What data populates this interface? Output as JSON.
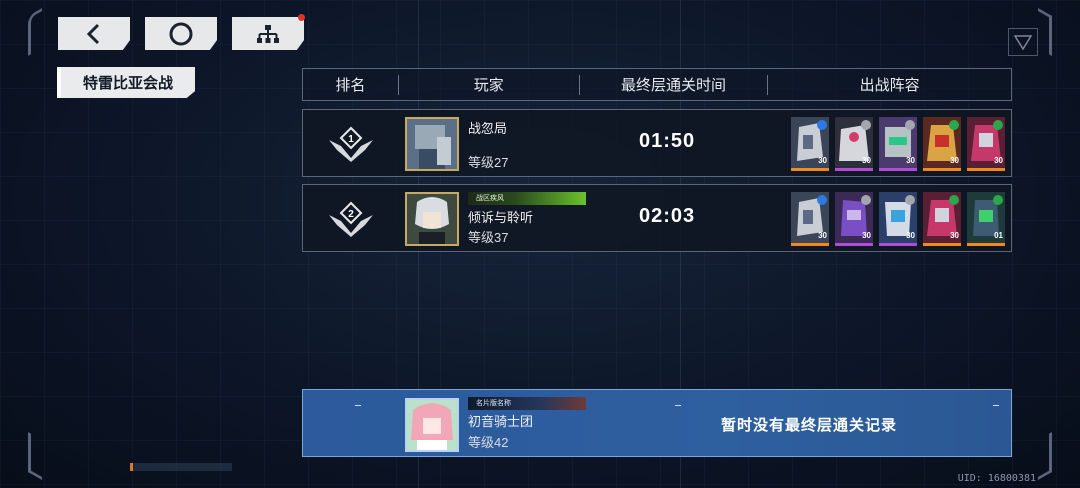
{
  "nav": {
    "back_icon": "chevron-left-icon",
    "home_icon": "circle-icon",
    "tree_icon": "hierarchy-icon"
  },
  "tab": {
    "title": "特雷比亚会战"
  },
  "table": {
    "headers": [
      "排名",
      "玩家",
      "最终层通关时间",
      "出战阵容"
    ],
    "rows": [
      {
        "rank": "1",
        "name": "战忽局",
        "level": "等级27",
        "banner": "",
        "time": "01:50",
        "team": [
          {
            "level": "30",
            "rarity": "orange"
          },
          {
            "level": "30",
            "rarity": "purple"
          },
          {
            "level": "30",
            "rarity": "purple"
          },
          {
            "level": "30",
            "rarity": "orange"
          },
          {
            "level": "30",
            "rarity": "orange"
          }
        ]
      },
      {
        "rank": "2",
        "name": "倾诉与聆听",
        "level": "等级37",
        "banner": "战区疾风",
        "time": "02:03",
        "team": [
          {
            "level": "30",
            "rarity": "orange"
          },
          {
            "level": "30",
            "rarity": "purple"
          },
          {
            "level": "30",
            "rarity": "purple"
          },
          {
            "level": "30",
            "rarity": "orange"
          },
          {
            "level": "01",
            "rarity": "orange"
          }
        ]
      }
    ]
  },
  "self": {
    "name": "初音骑士团",
    "level": "等级42",
    "banner": "名片版名称",
    "message": "暂时没有最终层通关记录"
  },
  "footer": {
    "uid": "UID: 16800381"
  },
  "colors": {
    "accent_orange": "#f08a1e",
    "accent_purple": "#b04cd8",
    "self_bar": "#2e5f9f"
  }
}
